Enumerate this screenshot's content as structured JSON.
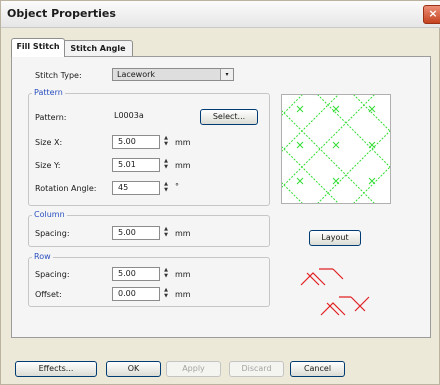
{
  "window": {
    "title": "Object Properties",
    "close_glyph": "×"
  },
  "tabs": [
    {
      "label": "Fill Stitch",
      "active": true
    },
    {
      "label": "Stitch Angle",
      "active": false
    }
  ],
  "stitch_type": {
    "label": "Stitch Type:",
    "value": "Lacework"
  },
  "pattern_group": {
    "title": "Pattern",
    "pattern": {
      "label": "Pattern:",
      "value": "L0003a",
      "select_button": "Select..."
    },
    "size_x": {
      "label": "Size X:",
      "value": "5.00",
      "unit": "mm"
    },
    "size_y": {
      "label": "Size Y:",
      "value": "5.01",
      "unit": "mm"
    },
    "rotation": {
      "label": "Rotation Angle:",
      "value": "45",
      "unit": "°"
    }
  },
  "column_group": {
    "title": "Column",
    "spacing": {
      "label": "Spacing:",
      "value": "5.00",
      "unit": "mm"
    }
  },
  "row_group": {
    "title": "Row",
    "spacing": {
      "label": "Spacing:",
      "value": "5.00",
      "unit": "mm"
    },
    "offset": {
      "label": "Offset:",
      "value": "0.00",
      "unit": "mm"
    }
  },
  "layout_button": "Layout",
  "bottom_buttons": {
    "effects": "Effects...",
    "ok": "OK",
    "apply": "Apply",
    "discard": "Discard",
    "cancel": "Cancel"
  },
  "colors": {
    "stitch_preview": "#33dd33",
    "layout_preview": "#e02020",
    "group_title": "#2a4fbf"
  }
}
